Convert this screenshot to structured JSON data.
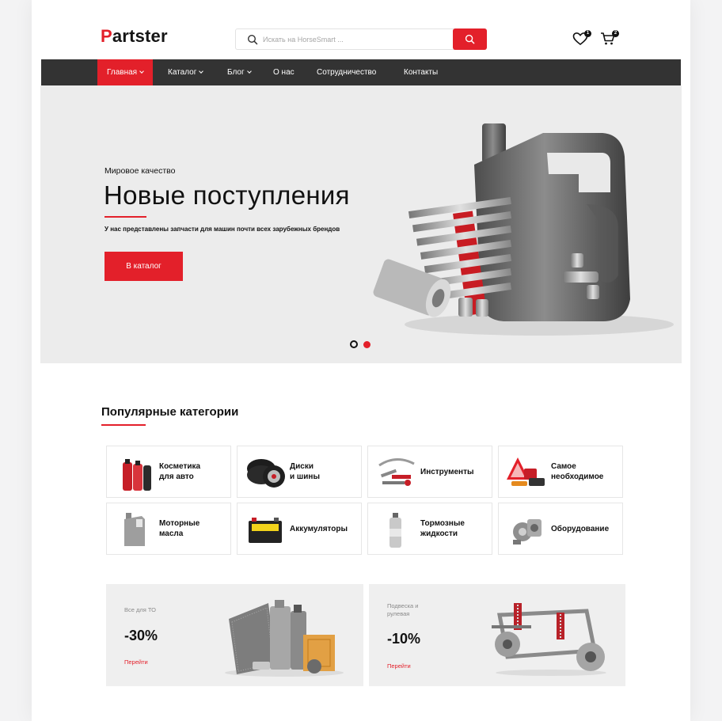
{
  "brand": {
    "logo_first": "P",
    "logo_rest": "artster"
  },
  "search": {
    "placeholder": "Искать на HorseSmart ..."
  },
  "header": {
    "wishlist_count": "1",
    "cart_count": "2"
  },
  "nav": {
    "items": [
      {
        "label": "Главная"
      },
      {
        "label": "Каталог"
      },
      {
        "label": "Блог"
      },
      {
        "label": "О нас"
      },
      {
        "label": "Сотрудничество"
      },
      {
        "label": "Контакты"
      }
    ]
  },
  "hero": {
    "eyebrow": "Мировое качество",
    "title": "Новые поступления",
    "text": "У нас представлены запчасти для машин почти всех зарубежных брендов",
    "button": "В каталог"
  },
  "categories": {
    "title": "Популярные категории",
    "items": [
      {
        "label": "Косметика\nдля авто"
      },
      {
        "label": "Диски\nи шины"
      },
      {
        "label": "Инструменты"
      },
      {
        "label": "Самое\nнеобходимое"
      },
      {
        "label": "Моторные\nмасла"
      },
      {
        "label": "Аккумуляторы"
      },
      {
        "label": "Тормозные\nжидкости"
      },
      {
        "label": "Оборудование"
      }
    ]
  },
  "promos": [
    {
      "caption": "Все для ТО",
      "discount": "-30%",
      "link": "Перейти"
    },
    {
      "caption": "Подвеска и\nрулевая",
      "discount": "-10%",
      "link": "Перейти"
    }
  ],
  "colors": {
    "accent": "#e3202a",
    "nav_bg": "#333333",
    "hero_bg": "#ececec"
  }
}
